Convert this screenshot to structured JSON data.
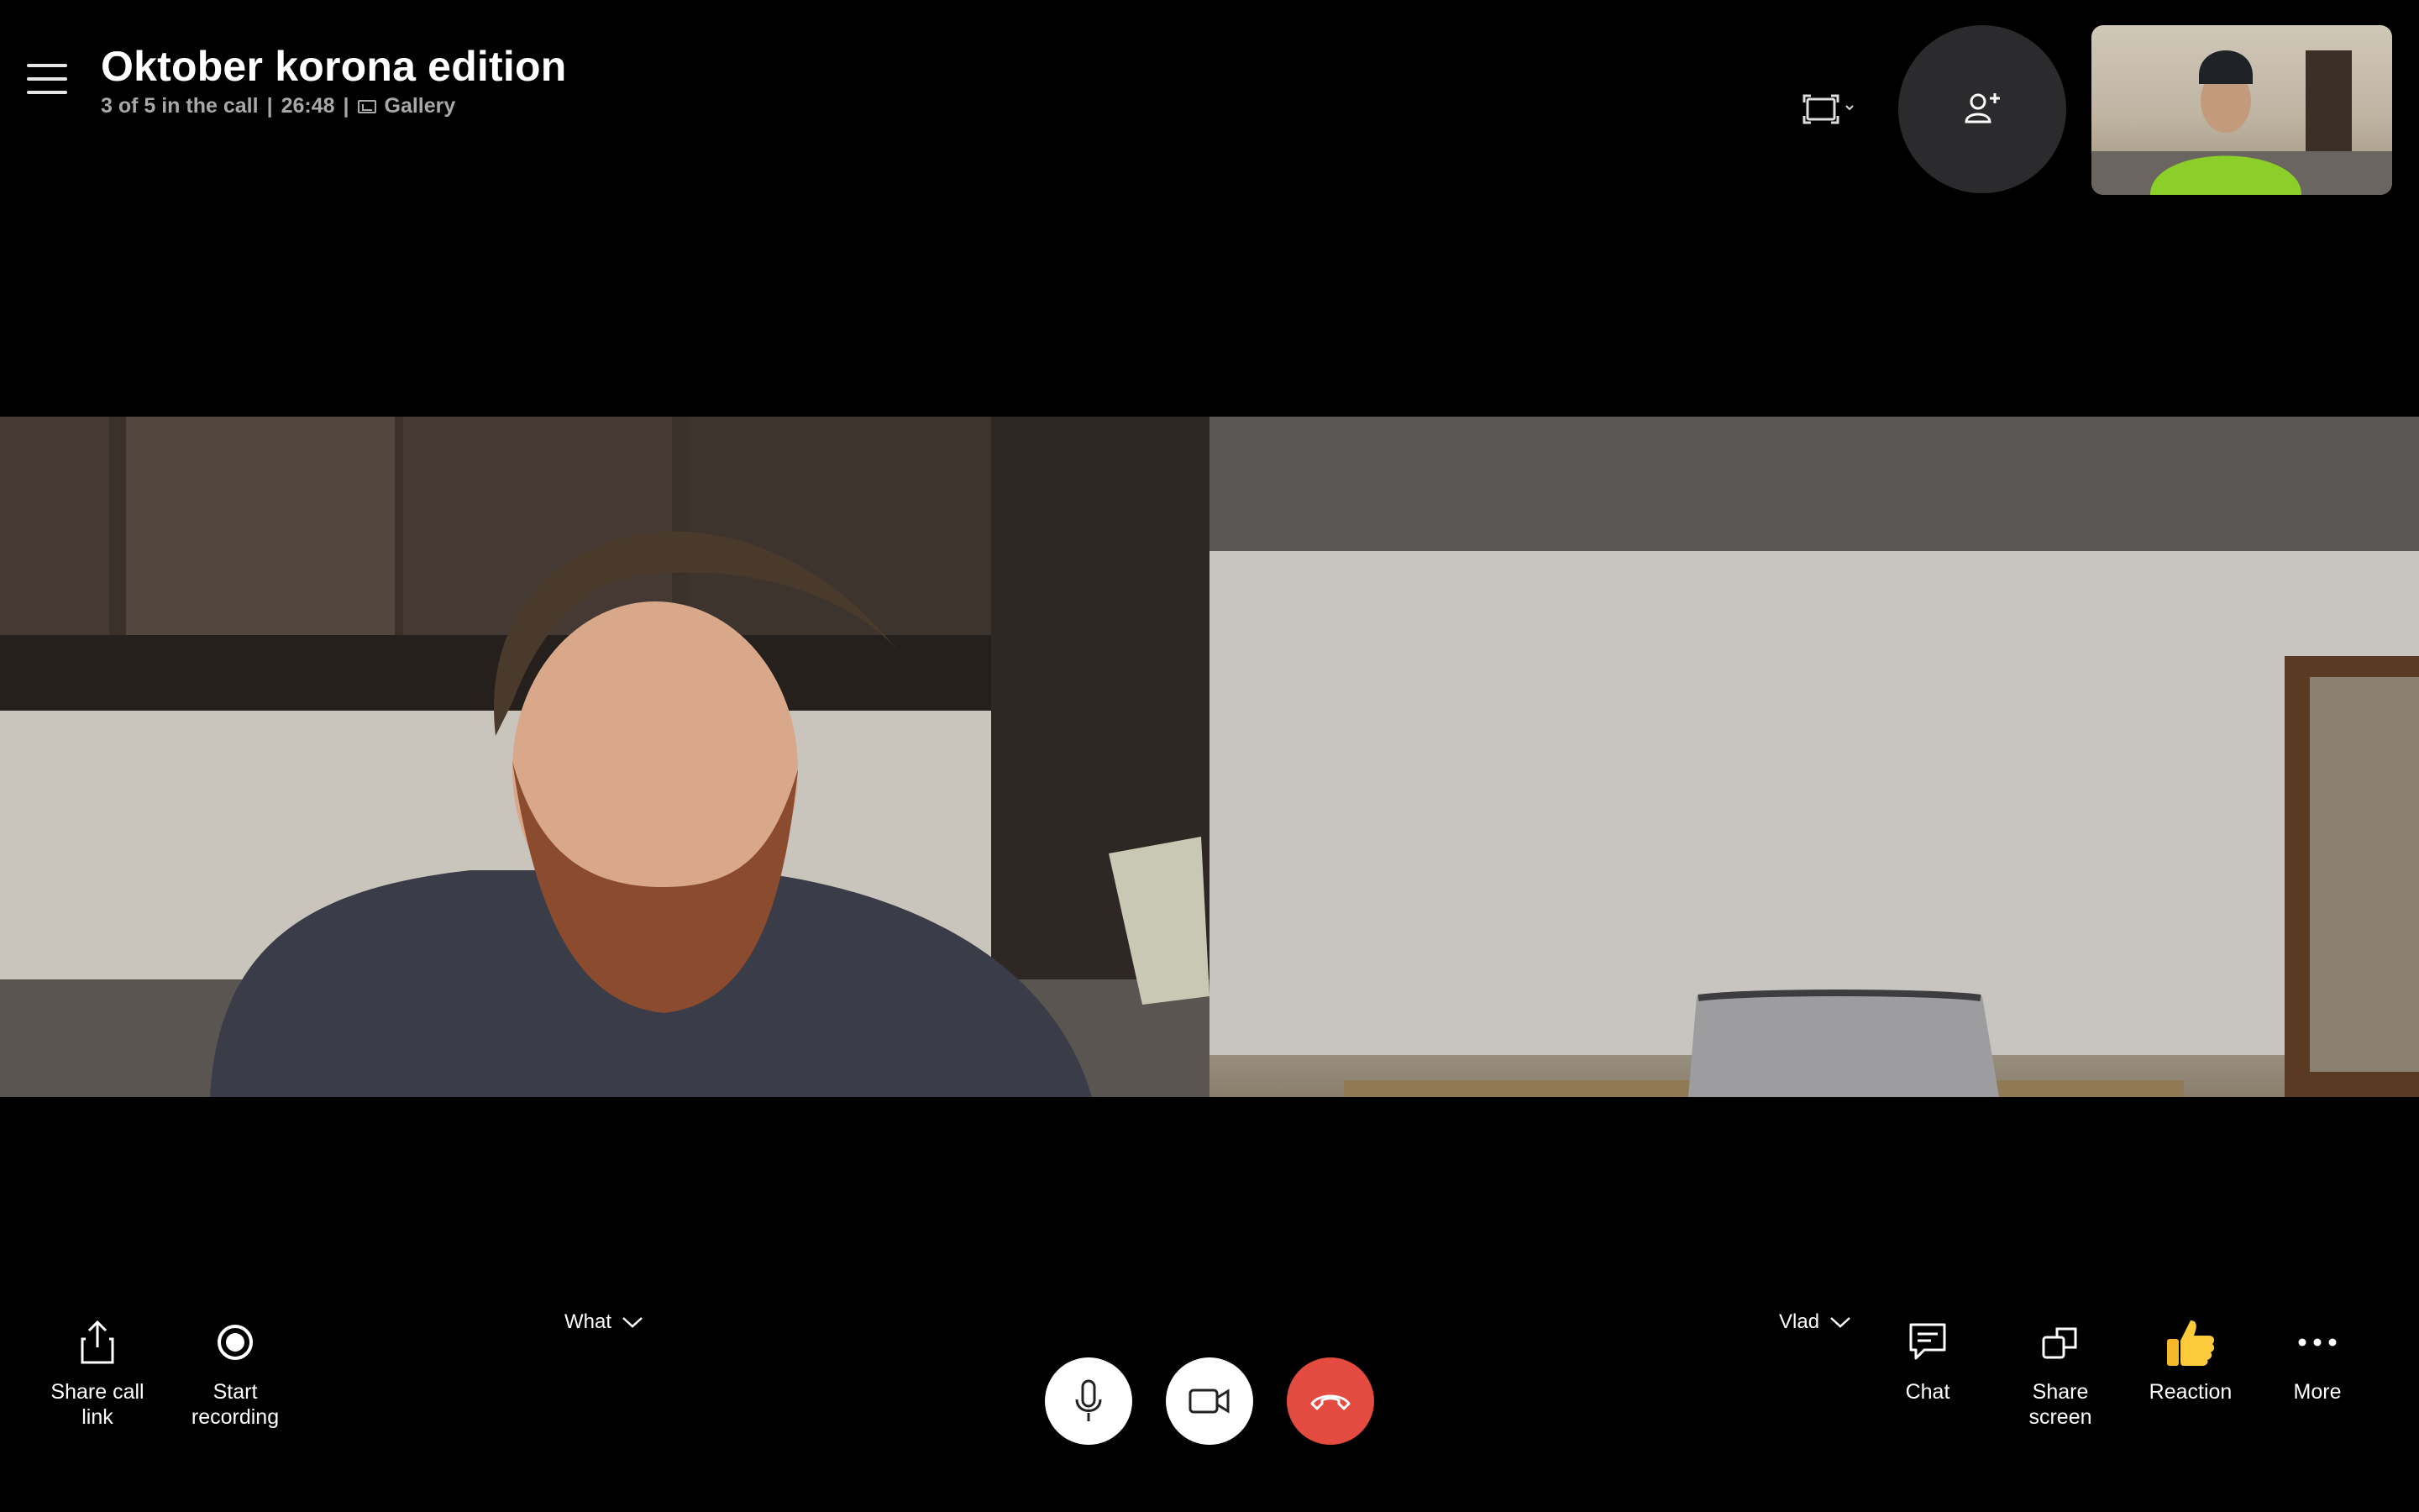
{
  "header": {
    "title": "Oktober korona edition",
    "participants": "3 of 5 in the call",
    "separator": "|",
    "duration": "26:48",
    "view_mode": "Gallery"
  },
  "icons": {
    "menu": "hamburger-menu-icon",
    "layout": "layout-frame-icon",
    "add_people": "add-person-icon",
    "share_link": "share-icon",
    "record": "record-icon",
    "mic": "microphone-icon",
    "camera": "video-camera-icon",
    "hangup": "hang-up-icon",
    "chat": "chat-icon",
    "share_screen": "share-screen-icon",
    "reaction": "thumbs-up-icon",
    "more": "ellipsis-icon"
  },
  "controls": {
    "share_link_label_1": "Share call",
    "share_link_label_2": "link",
    "record_label_1": "Start",
    "record_label_2": "recording",
    "mic_source": "What",
    "camera_source": "Vlad",
    "chat_label": "Chat",
    "share_screen_label_1": "Share",
    "share_screen_label_2": "screen",
    "reaction_label": "Reaction",
    "more_label": "More"
  },
  "colors": {
    "background": "#000000",
    "end_call": "#e34a40",
    "add_people_bg": "#2b2b2d",
    "subtitle": "#a8a8a8"
  }
}
